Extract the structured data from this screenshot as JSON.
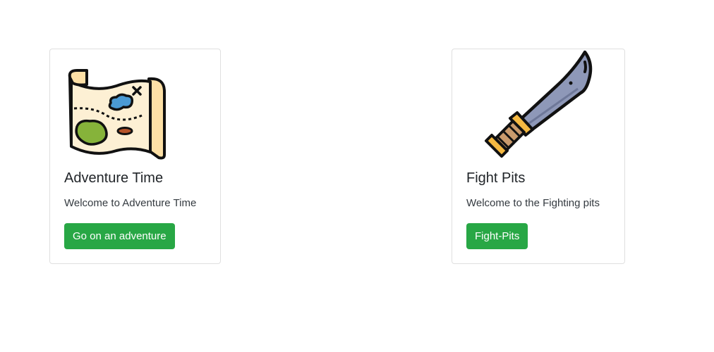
{
  "cards": [
    {
      "icon": "treasure-map-icon",
      "title": "Adventure Time",
      "text": "Welcome to Adventure Time",
      "button_label": "Go on an adventure"
    },
    {
      "icon": "machete-sword-icon",
      "title": "Fight Pits",
      "text": "Welcome to the Fighting pits",
      "button_label": "Fight-Pits"
    }
  ],
  "colors": {
    "button_bg": "#28a745",
    "button_text": "#ffffff",
    "card_border": "#dfdfdf",
    "map_paper": "#fde0a6",
    "map_island_green": "#86b33a",
    "map_island_blue": "#4a9ad4",
    "blade": "#8e98b8",
    "handle": "#f5b942"
  }
}
